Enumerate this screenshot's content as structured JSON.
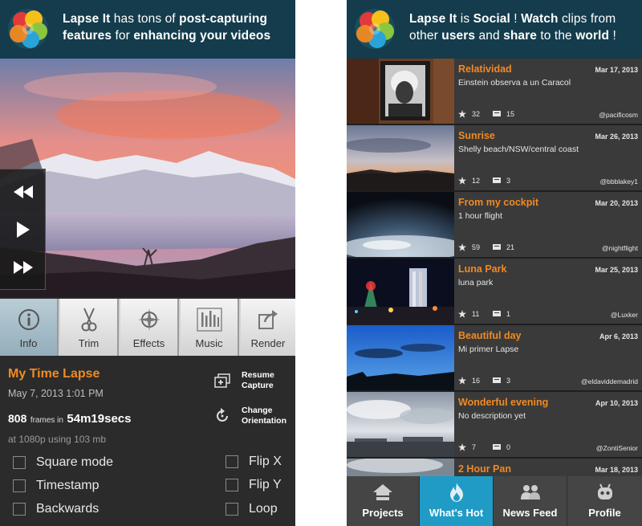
{
  "left_screen": {
    "banner": {
      "parts": [
        {
          "text": "Lapse It",
          "bold": true
        },
        {
          "text": " has tons of ",
          "bold": false
        },
        {
          "text": "post-capturing",
          "bold": true
        },
        {
          "text": " features",
          "bold": true
        },
        {
          "text": " for ",
          "bold": false
        },
        {
          "text": "enhancing your videos",
          "bold": true
        }
      ]
    },
    "transport": {
      "rewind_icon": "rewind-icon",
      "play_icon": "play-icon",
      "forward_icon": "fast-forward-icon"
    },
    "tools": [
      {
        "label": "Info",
        "icon": "info-icon",
        "active": true
      },
      {
        "label": "Trim",
        "icon": "scissors-icon",
        "active": false
      },
      {
        "label": "Effects",
        "icon": "compass-icon",
        "active": false
      },
      {
        "label": "Music",
        "icon": "music-bars-icon",
        "active": false
      },
      {
        "label": "Render",
        "icon": "share-out-icon",
        "active": false
      }
    ],
    "project": {
      "title": "My Time Lapse",
      "date": "May 7, 2013 1:01 PM",
      "frames_count": "808",
      "frames_in": "frames in",
      "duration": "54m19secs",
      "quality": "at 1080p using 103 mb"
    },
    "actions": {
      "resume_line1": "Resume",
      "resume_line2": "Capture",
      "orient_line1": "Change",
      "orient_line2": "Orientation"
    },
    "options": {
      "square_mode": "Square mode",
      "timestamp": "Timestamp",
      "backwards": "Backwards",
      "flip_x": "Flip X",
      "flip_y": "Flip Y",
      "loop": "Loop"
    }
  },
  "right_screen": {
    "banner": {
      "parts": [
        {
          "text": "Lapse It",
          "bold": true
        },
        {
          "text": " is ",
          "bold": false
        },
        {
          "text": "Social",
          "bold": true
        },
        {
          "text": " ! ",
          "bold": false
        },
        {
          "text": "Watch",
          "bold": true
        },
        {
          "text": " clips from other ",
          "bold": false
        },
        {
          "text": "users",
          "bold": true
        },
        {
          "text": " and ",
          "bold": false
        },
        {
          "text": "share",
          "bold": true
        },
        {
          "text": " to the ",
          "bold": false
        },
        {
          "text": "world",
          "bold": true
        },
        {
          "text": " !",
          "bold": false
        }
      ]
    },
    "clips": [
      {
        "title": "Relatividad",
        "date": "Mar 17, 2013",
        "desc": "Einstein observa a un Caracol",
        "stars": "32",
        "comments": "15",
        "user": "@pacificosm"
      },
      {
        "title": "Sunrise",
        "date": "Mar 26, 2013",
        "desc": "Shelly beach/NSW/central coast",
        "stars": "12",
        "comments": "3",
        "user": "@bbblakey1"
      },
      {
        "title": "From my cockpit",
        "date": "Mar 20, 2013",
        "desc": "1 hour flight",
        "stars": "59",
        "comments": "21",
        "user": "@nightflight"
      },
      {
        "title": "Luna Park",
        "date": "Mar 25, 2013",
        "desc": "luna park",
        "stars": "11",
        "comments": "1",
        "user": "@Luxker"
      },
      {
        "title": "Beautiful day",
        "date": "Apr 6, 2013",
        "desc": "Mi primer Lapse",
        "stars": "16",
        "comments": "3",
        "user": "@eldaviddemadrid"
      },
      {
        "title": "Wonderful evening",
        "date": "Apr 10, 2013",
        "desc": "No description yet",
        "stars": "7",
        "comments": "0",
        "user": "@ZontiSenior"
      },
      {
        "title": "2 Hour Pan",
        "date": "Mar 18, 2013",
        "desc": "",
        "stars": "",
        "comments": "",
        "user": ""
      }
    ],
    "nav": [
      {
        "label": "Projects",
        "icon": "house-icon",
        "active": false
      },
      {
        "label": "What's Hot",
        "icon": "flame-icon",
        "active": true
      },
      {
        "label": "News Feed",
        "icon": "people-icon",
        "active": false
      },
      {
        "label": "Profile",
        "icon": "robot-icon",
        "active": false
      }
    ]
  },
  "colors": {
    "banner_bg": "#143c4c",
    "accent_orange": "#f08a24",
    "active_tab": "#1f9bc6",
    "panel_bg": "#2b2b2b"
  }
}
